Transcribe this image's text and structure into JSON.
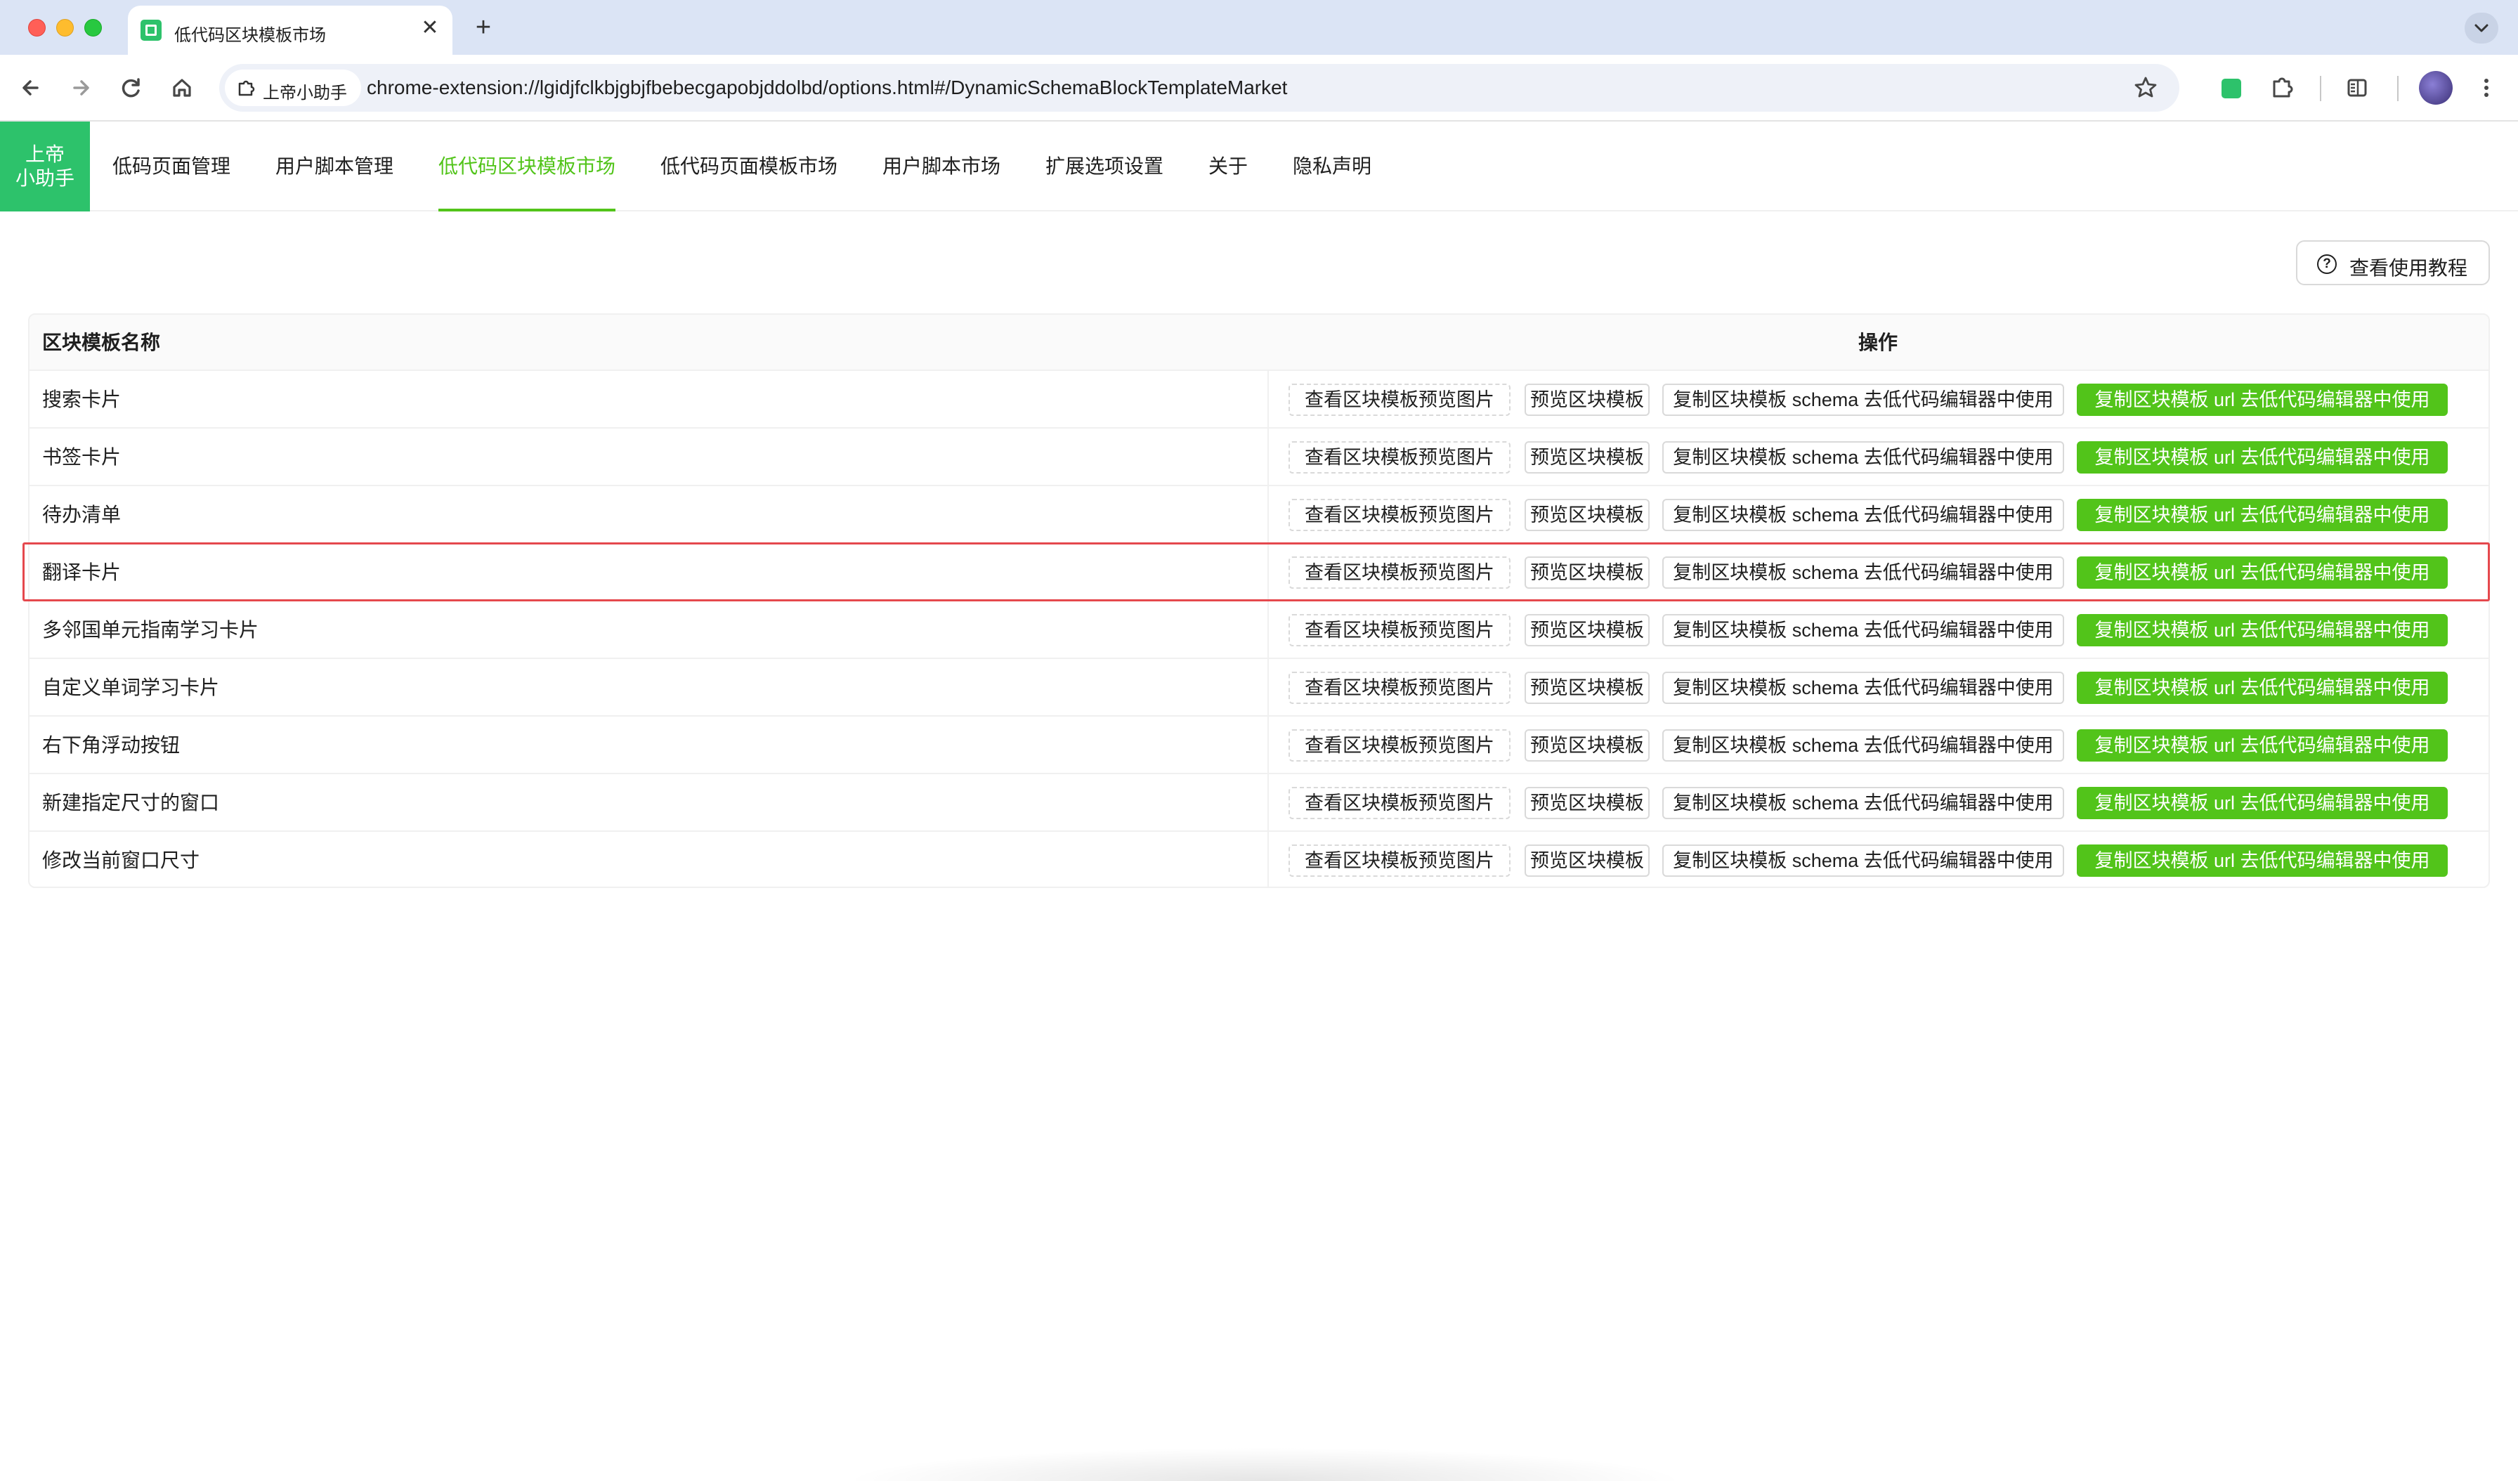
{
  "browser": {
    "tab_title": "低代码区块模板市场",
    "tab_close": "✕",
    "new_tab": "+",
    "site_chip": "上帝小助手",
    "url": "chrome-extension://lgidjfclkbjgbjfbebecgapobjddolbd/options.html#/DynamicSchemaBlockTemplateMarket"
  },
  "app": {
    "logo": [
      "上帝",
      "小助手"
    ],
    "menu": [
      {
        "label": "低码页面管理",
        "active": false
      },
      {
        "label": "用户脚本管理",
        "active": false
      },
      {
        "label": "低代码区块模板市场",
        "active": true
      },
      {
        "label": "低代码页面模板市场",
        "active": false
      },
      {
        "label": "用户脚本市场",
        "active": false
      },
      {
        "label": "扩展选项设置",
        "active": false
      },
      {
        "label": "关于",
        "active": false
      },
      {
        "label": "隐私声明",
        "active": false
      }
    ],
    "help_button": "查看使用教程",
    "accent": "#52c41a",
    "brand": "#2dc26b",
    "highlight_color": "#e5484d"
  },
  "table": {
    "columns": {
      "name": "区块模板名称",
      "ops": "操作"
    },
    "actions": {
      "view_image": "查看区块模板预览图片",
      "preview": "预览区块模板",
      "copy_schema": "复制区块模板 schema 去低代码编辑器中使用",
      "copy_url": "复制区块模板 url 去低代码编辑器中使用"
    },
    "rows": [
      {
        "name": "搜索卡片"
      },
      {
        "name": "书签卡片"
      },
      {
        "name": "待办清单"
      },
      {
        "name": "翻译卡片",
        "highlighted": true
      },
      {
        "name": "多邻国单元指南学习卡片"
      },
      {
        "name": "自定义单词学习卡片"
      },
      {
        "name": "右下角浮动按钮"
      },
      {
        "name": "新建指定尺寸的窗口"
      },
      {
        "name": "修改当前窗口尺寸"
      }
    ]
  }
}
